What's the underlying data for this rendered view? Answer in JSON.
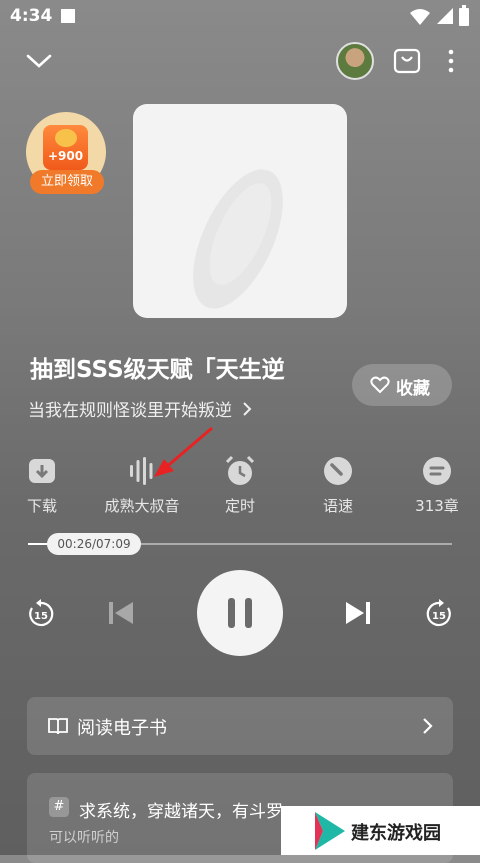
{
  "status_bar": {
    "time": "4:34"
  },
  "badge": {
    "amount": "+900",
    "claim_label": "立即领取"
  },
  "book": {
    "title": "抽到SSS级天赋「天生逆",
    "subtitle": "当我在规则怪谈里开始叛逆",
    "favorite_label": "收藏"
  },
  "actions": [
    {
      "label": "下载",
      "icon": "download-icon"
    },
    {
      "label": "成熟大叔音",
      "icon": "voice-wave-icon"
    },
    {
      "label": "定时",
      "icon": "alarm-clock-icon"
    },
    {
      "label": "语速",
      "icon": "speed-dial-icon"
    },
    {
      "label": "313章",
      "icon": "chapters-icon"
    }
  ],
  "progress": {
    "time_text": "00:26/07:09",
    "fraction": 0.06
  },
  "controls": {
    "rewind_seconds": "15",
    "forward_seconds": "15"
  },
  "read_ebook": {
    "label": "阅读电子书"
  },
  "recommend": {
    "title": "求系统，穿越诸天，有斗罗",
    "subtitle": "可以听听的"
  },
  "watermark": {
    "text": "建东游戏园"
  }
}
